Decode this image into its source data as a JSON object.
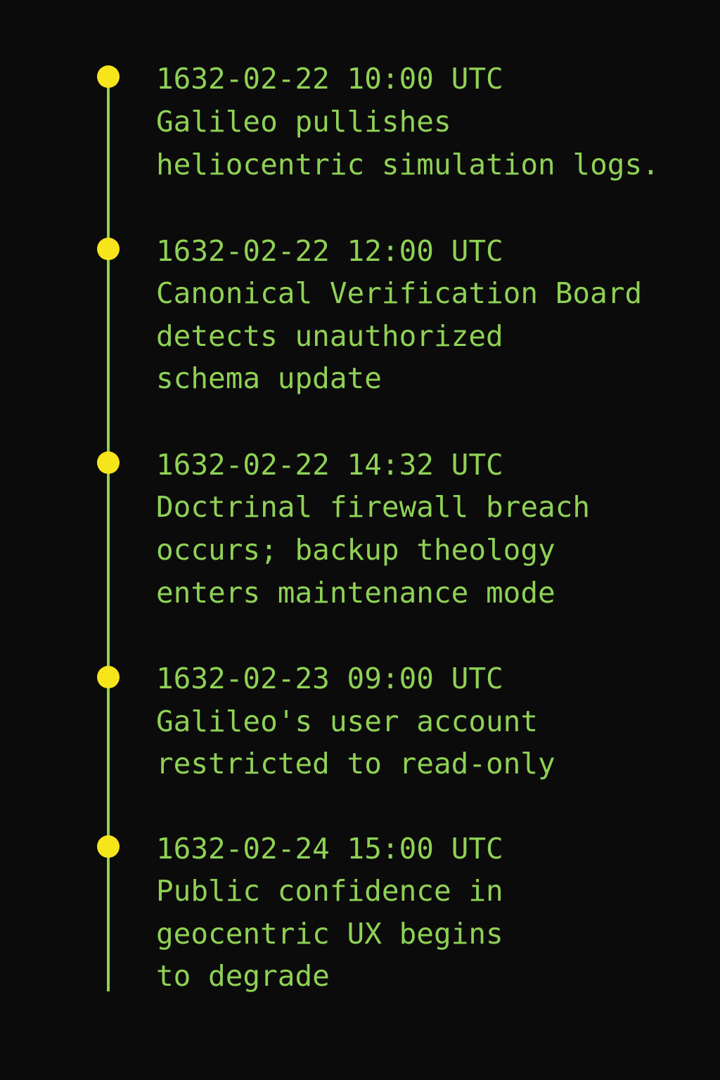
{
  "colors": {
    "background": "#0b0b0b",
    "text": "#8fd155",
    "line": "#8fd155",
    "dot": "#f7e51c"
  },
  "events": [
    {
      "timestamp": "1632-02-22 10:00 UTC",
      "lines": [
        "Galileo pullishes",
        "heliocentric simulation logs."
      ]
    },
    {
      "timestamp": "1632-02-22 12:00 UTC",
      "lines": [
        "Canonical Verification Board",
        "detects unauthorized",
        "schema update"
      ]
    },
    {
      "timestamp": "1632-02-22 14:32 UTC",
      "lines": [
        "Doctrinal firewall breach",
        "occurs; backup theology",
        "enters maintenance mode"
      ]
    },
    {
      "timestamp": "1632-02-23 09:00 UTC",
      "lines": [
        "Galileo's user account",
        "restricted to read-only"
      ]
    },
    {
      "timestamp": "1632-02-24 15:00 UTC",
      "lines": [
        "Public confidence in",
        "geocentric UX begins",
        "to degrade"
      ]
    }
  ]
}
